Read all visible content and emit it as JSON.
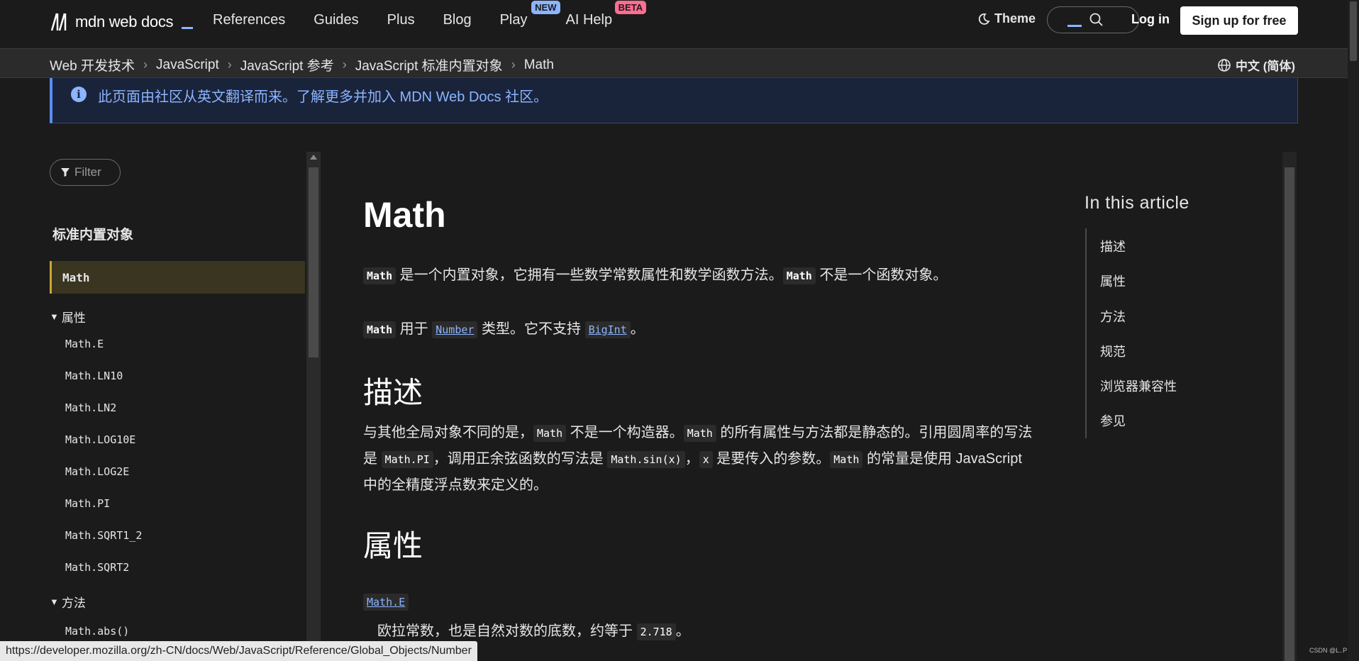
{
  "header": {
    "logo_text": "mdn web docs",
    "nav": [
      {
        "label": "References"
      },
      {
        "label": "Guides"
      },
      {
        "label": "Plus"
      },
      {
        "label": "Blog"
      },
      {
        "label": "Play",
        "badge": "NEW"
      },
      {
        "label": "AI Help",
        "badge": "BETA"
      }
    ],
    "theme_label": "Theme",
    "login_label": "Log in",
    "signup_label": "Sign up for free"
  },
  "breadcrumb": {
    "items": [
      "Web 开发技术",
      "JavaScript",
      "JavaScript 参考",
      "JavaScript 标准内置对象",
      "Math"
    ],
    "language": "中文 (简体)"
  },
  "notice": {
    "text": "此页面由社区从英文翻译而来。了解更多并加入 MDN Web Docs 社区。"
  },
  "sidebar": {
    "filter_placeholder": "Filter",
    "title": "标准内置对象",
    "active_item": "Math",
    "groups": [
      {
        "label": "属性",
        "items": [
          "Math.E",
          "Math.LN10",
          "Math.LN2",
          "Math.LOG10E",
          "Math.LOG2E",
          "Math.PI",
          "Math.SQRT1_2",
          "Math.SQRT2"
        ]
      },
      {
        "label": "方法",
        "items": [
          "Math.abs()"
        ]
      }
    ]
  },
  "article": {
    "title": "Math",
    "intro1": {
      "code1": "Math",
      "t1": " 是一个内置对象，它拥有一些数学常数属性和数学函数方法。",
      "code2": "Math",
      "t2": " 不是一个函数对象。"
    },
    "intro2": {
      "code1": "Math",
      "t1": " 用于 ",
      "link1": "Number",
      "t2": " 类型。它不支持 ",
      "link2": "BigInt",
      "t3": "。"
    },
    "desc_heading": "描述",
    "desc": {
      "t1": "与其他全局对象不同的是，",
      "c1": "Math",
      "t2": " 不是一个构造器。",
      "c2": "Math",
      "t3": " 的所有属性与方法都是静态的。引用圆周率的写法",
      "t4": "是 ",
      "c3": "Math.PI",
      "t5": "，调用正余弦函数的写法是 ",
      "c4": "Math.sin(x)",
      "t6": "，",
      "c5": "x",
      "t7": " 是要传入的参数。",
      "c6": "Math",
      "t8": " 的常量是使用 JavaScript",
      "t9": "中的全精度浮点数来定义的。"
    },
    "props_heading": "属性",
    "prop_link": "Math.E",
    "prop_desc": {
      "t1": "欧拉常数，也是自然对数的底数，约等于 ",
      "code": "2.718",
      "t2": "。"
    }
  },
  "toc": {
    "title": "In this article",
    "items": [
      "描述",
      "属性",
      "方法",
      "规范",
      "浏览器兼容性",
      "参见"
    ]
  },
  "status_url": "https://developer.mozilla.org/zh-CN/docs/Web/JavaScript/Reference/Global_Objects/Number",
  "watermark": "CSDN @L..P",
  "colors": {
    "background": "#1b1b1b",
    "accent_blue": "#8cb4ff",
    "badge_beta": "#ff6d91",
    "active_border": "#c8a73a"
  }
}
